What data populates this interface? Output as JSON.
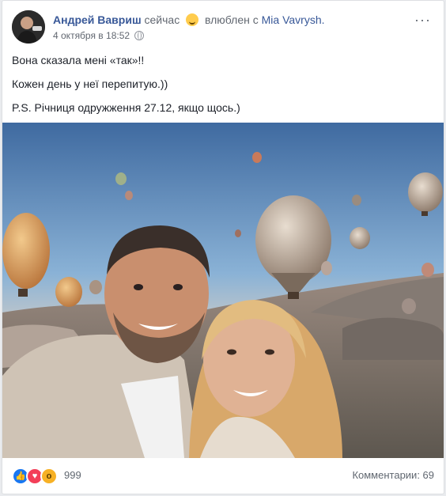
{
  "post": {
    "author": "Андрей Вавриш",
    "status_time": "сейчас",
    "feeling": "влюблен с",
    "tagged": "Mia Vavrysh.",
    "date": "4 октября в 18:52",
    "lines": [
      "Вона сказала мені «так»!!",
      "Кожен день у неї перепитую.))",
      "P.S. Річниця одружження 27.12, якщо щось.)"
    ]
  },
  "footer": {
    "reaction_count": "999",
    "comments": "Комментарии: 69"
  },
  "colors": {
    "link": "#385898",
    "like": "#1877f2",
    "love": "#f33e58",
    "wow": "#f7b125"
  }
}
